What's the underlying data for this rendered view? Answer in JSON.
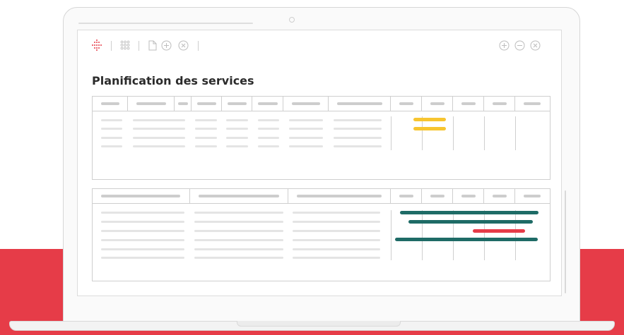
{
  "app": {
    "title": "Planification des services"
  },
  "toolbar": {
    "icons_left": [
      "logo-icon",
      "apps-grid-icon",
      "document-icon",
      "add-icon",
      "close-icon"
    ],
    "icons_right": [
      "zoom-in-icon",
      "zoom-out-icon",
      "close-window-icon"
    ]
  },
  "tables": [
    {
      "name": "top-schedule",
      "rows": 4,
      "gantt_bars": [
        {
          "row": 0,
          "color": "#f7c530"
        },
        {
          "row": 1,
          "color": "#f7c530"
        }
      ]
    },
    {
      "name": "bottom-schedule",
      "rows": 6,
      "gantt_bars": [
        {
          "row": 0,
          "color": "#1e6b66"
        },
        {
          "row": 1,
          "color": "#1e6b66"
        },
        {
          "row": 2,
          "color": "#e63c48"
        },
        {
          "row": 3,
          "color": "#1e6b66"
        }
      ]
    }
  ],
  "colors": {
    "accent_red": "#e63c48",
    "teal": "#1e6b66",
    "yellow": "#f7c530"
  }
}
